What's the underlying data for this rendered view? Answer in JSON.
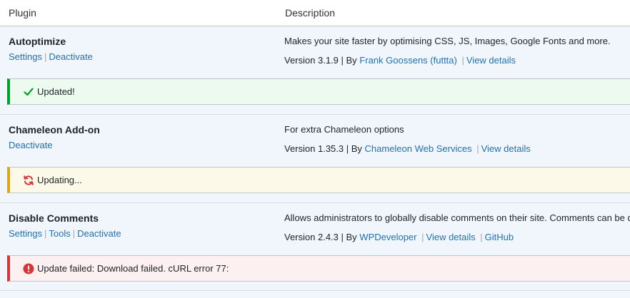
{
  "header": {
    "plugin_label": "Plugin",
    "description_label": "Description"
  },
  "plugins": [
    {
      "name": "Autoptimize",
      "actions": [
        "Settings",
        "Deactivate"
      ],
      "description": "Makes your site faster by optimising CSS, JS, Images, Google Fonts and more.",
      "version_text": "Version 3.1.9 | By",
      "author": "Frank Goossens (futtta)",
      "links": [
        "View details"
      ],
      "notice": {
        "type": "success",
        "text": "Updated!",
        "icon": "checkmark-icon"
      }
    },
    {
      "name": "Chameleon Add-on",
      "actions": [
        "Deactivate"
      ],
      "description": "For extra Chameleon options",
      "version_text": "Version 1.35.3 | By",
      "author": "Chameleon Web Services",
      "links": [
        "View details"
      ],
      "notice": {
        "type": "updating",
        "text": "Updating...",
        "icon": "refresh-icon"
      }
    },
    {
      "name": "Disable Comments",
      "actions": [
        "Settings",
        "Tools",
        "Deactivate"
      ],
      "description": "Allows administrators to globally disable comments on their site. Comments can be d",
      "version_text": "Version 2.4.3 | By",
      "author": "WPDeveloper",
      "links": [
        "View details",
        "GitHub"
      ],
      "notice": {
        "type": "error",
        "text": "Update failed: Download failed. cURL error 77:",
        "icon": "error-icon"
      }
    }
  ],
  "colors": {
    "link": "#2271b1",
    "success": "#00a32a",
    "warning": "#dba617",
    "error": "#d63638",
    "row_bg": "#f0f6fc"
  }
}
